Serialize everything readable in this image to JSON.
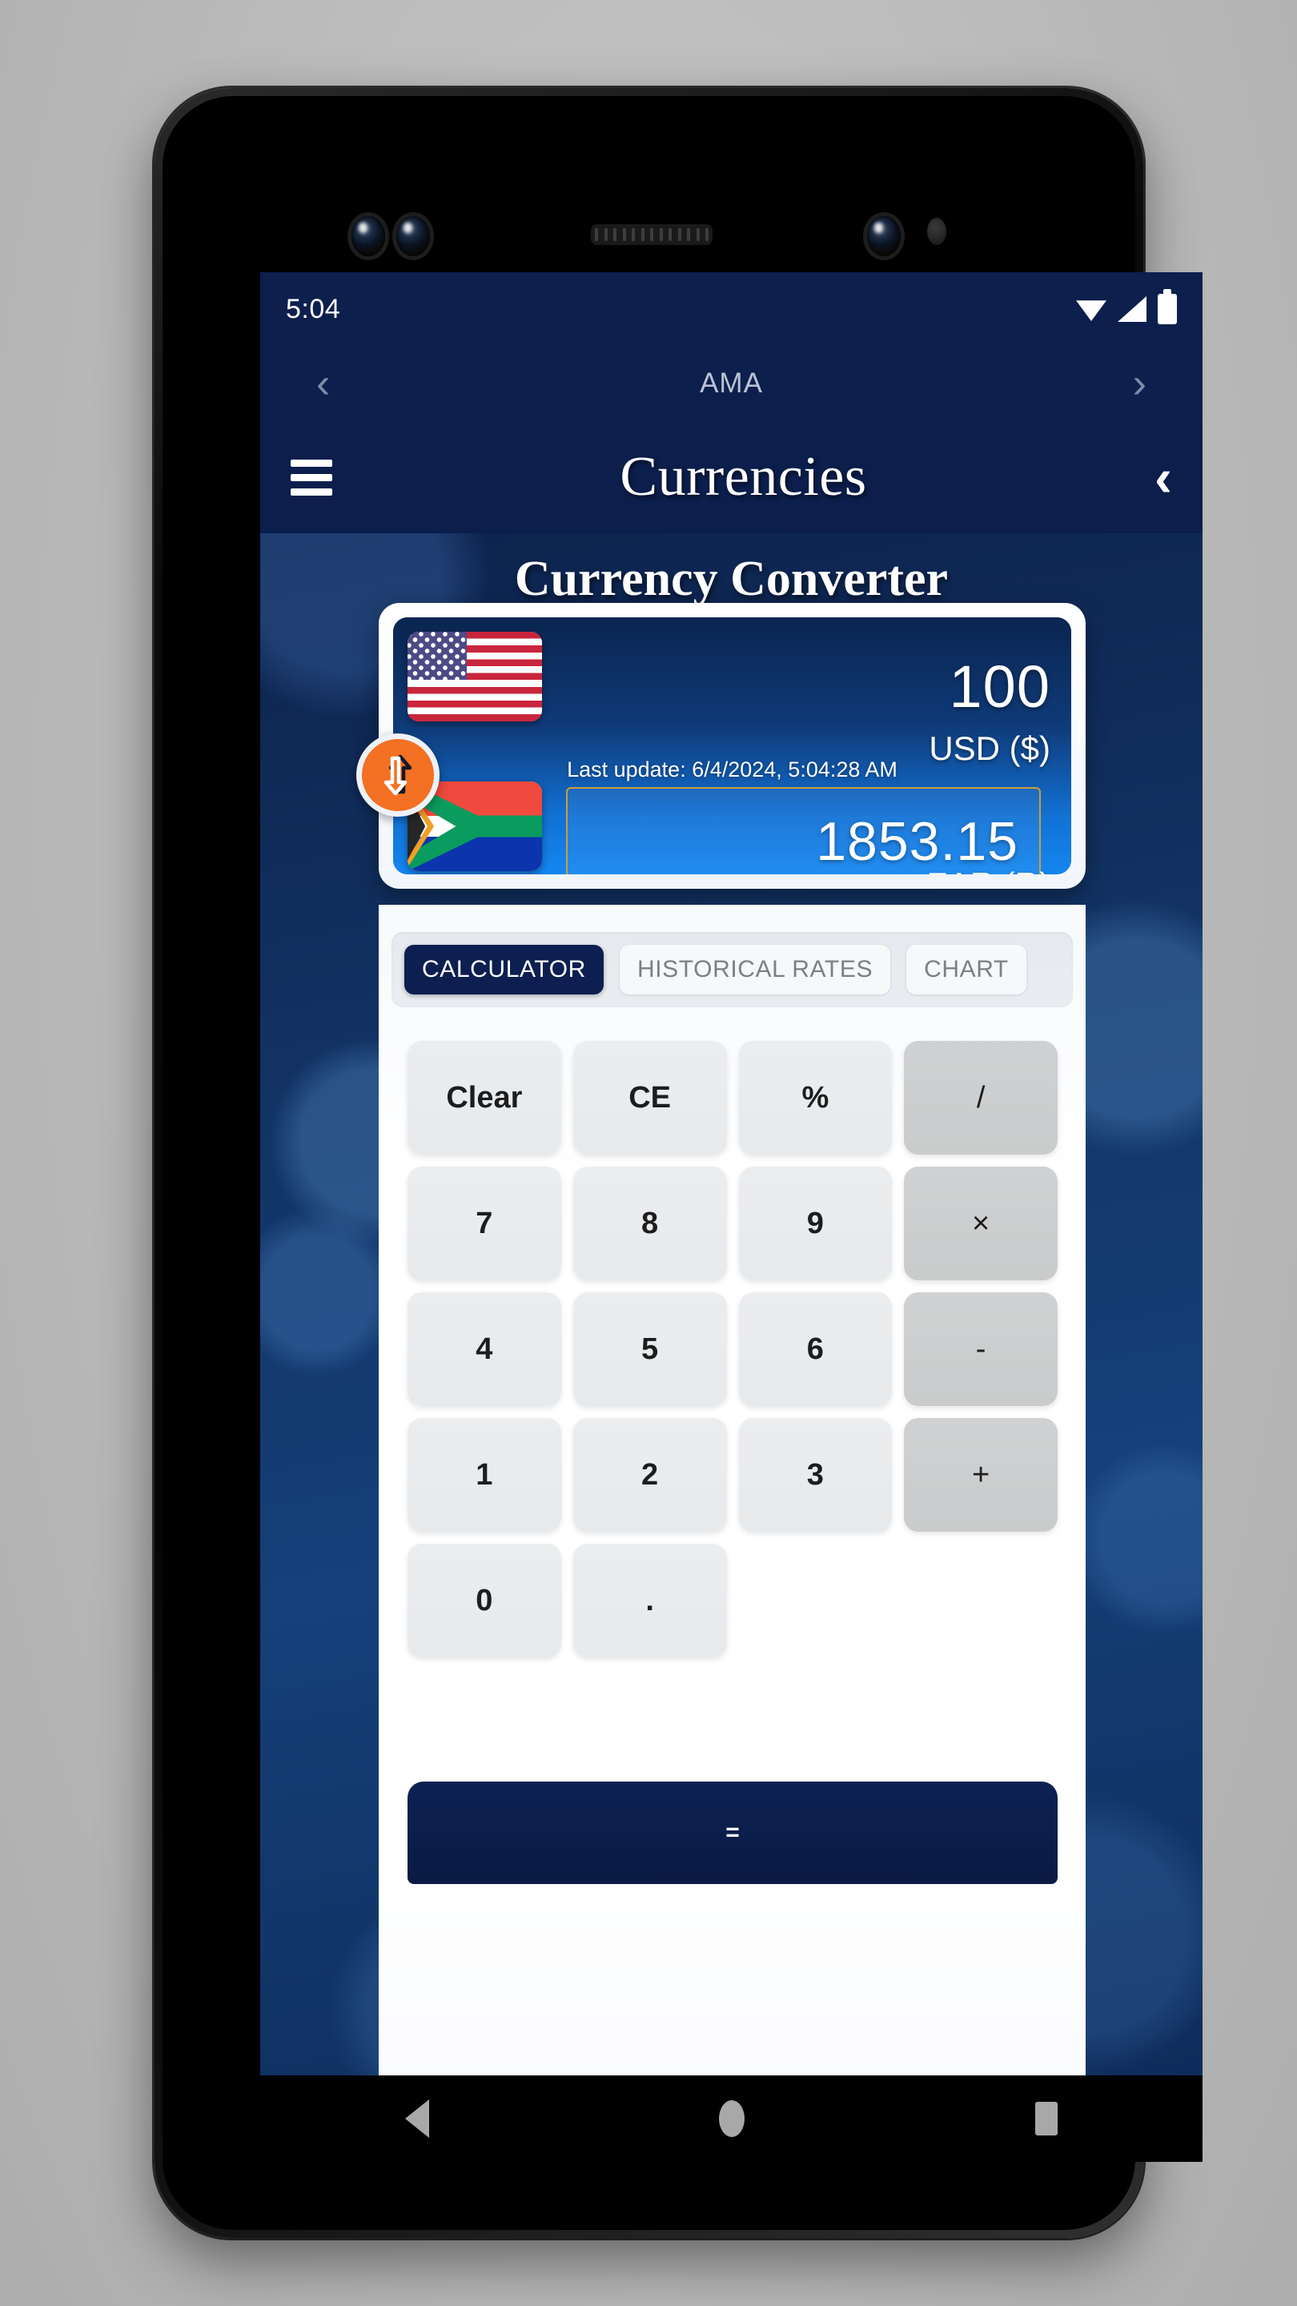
{
  "status_bar": {
    "clock": "5:04",
    "icons": [
      "wifi-icon",
      "signal-icon",
      "battery-icon"
    ]
  },
  "browser_bar": {
    "back_glyph": "‹",
    "title": "AMA",
    "forward_glyph": "›"
  },
  "app_header": {
    "menu_icon": "hamburger-icon",
    "title": "Currencies",
    "back_glyph": "‹"
  },
  "page": {
    "title": "Currency Converter"
  },
  "converter": {
    "from": {
      "flag": "us-flag-icon",
      "amount": "100",
      "label": "USD ($)"
    },
    "to": {
      "flag": "za-flag-icon",
      "amount": "1853.15",
      "label": "ZAR (R)"
    },
    "last_update": "Last update: 6/4/2024, 5:04:28 AM",
    "swap_icon": "swap-vertical-icon",
    "accent_orange": "#f47022",
    "result_border": "#cf9d35",
    "card_gradient_top": "#0a2550",
    "card_gradient_bottom": "#1486f0"
  },
  "tabs": [
    {
      "label": "CALCULATOR",
      "active": true
    },
    {
      "label": "HISTORICAL RATES",
      "active": false
    },
    {
      "label": "CHART",
      "active": false
    }
  ],
  "calculator": {
    "keys": [
      {
        "label": "Clear",
        "type": "func"
      },
      {
        "label": "CE",
        "type": "func"
      },
      {
        "label": "%",
        "type": "func"
      },
      {
        "label": "/",
        "type": "op"
      },
      {
        "label": "7",
        "type": "num"
      },
      {
        "label": "8",
        "type": "num"
      },
      {
        "label": "9",
        "type": "num"
      },
      {
        "label": "×",
        "type": "op"
      },
      {
        "label": "4",
        "type": "num"
      },
      {
        "label": "5",
        "type": "num"
      },
      {
        "label": "6",
        "type": "num"
      },
      {
        "label": "-",
        "type": "op"
      },
      {
        "label": "1",
        "type": "num"
      },
      {
        "label": "2",
        "type": "num"
      },
      {
        "label": "3",
        "type": "num"
      },
      {
        "label": "+",
        "type": "op"
      },
      {
        "label": "0",
        "type": "num"
      },
      {
        "label": ".",
        "type": "num"
      },
      {
        "label": "",
        "type": "blank"
      },
      {
        "label": "",
        "type": "blank"
      }
    ],
    "equals_label": "="
  },
  "nav_bar": {
    "back": "back-triangle-icon",
    "home": "home-circle-icon",
    "recents": "recents-square-icon"
  }
}
